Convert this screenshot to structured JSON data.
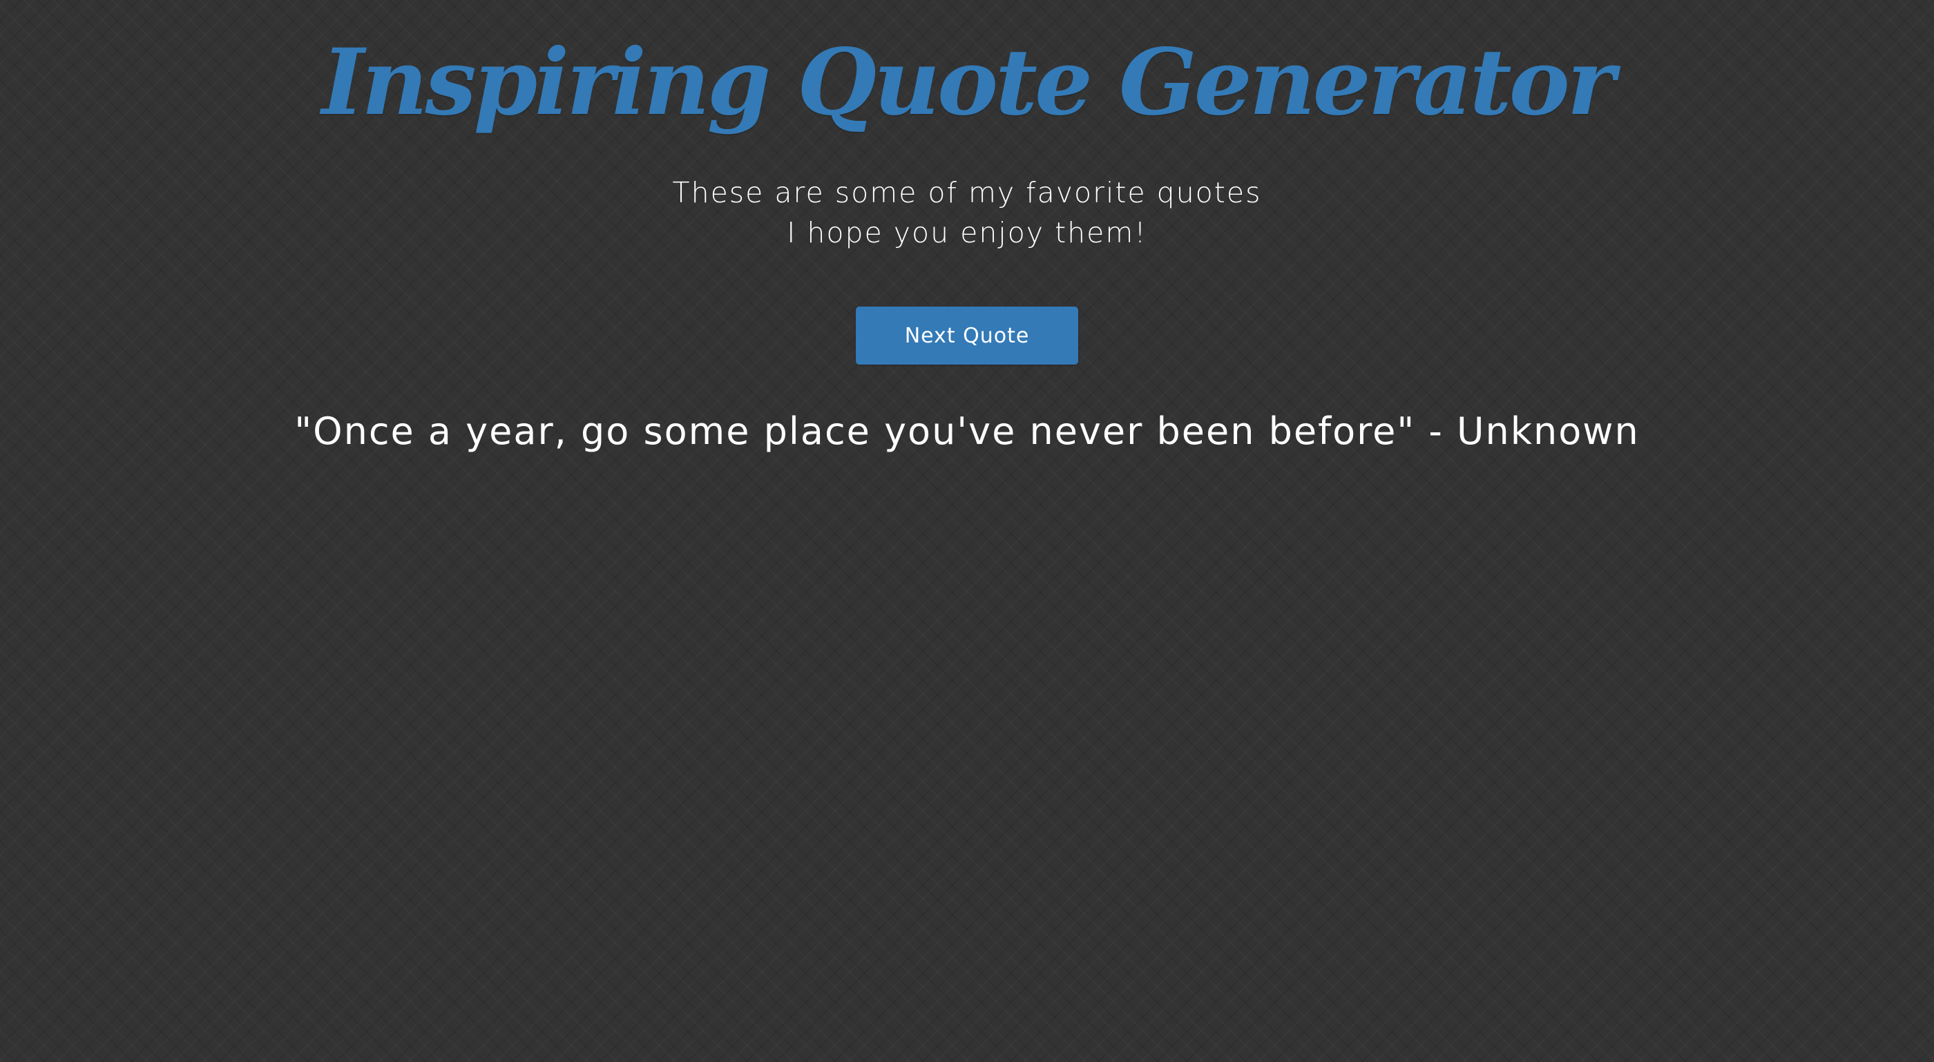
{
  "header": {
    "title": "Inspiring Quote Generator",
    "subtitle_line1": "These are some of my favorite quotes",
    "subtitle_line2": "I hope you enjoy them!"
  },
  "actions": {
    "next_quote_label": "Next Quote"
  },
  "quote": {
    "text": "\"Once a year, go some place you've never been before\" - Unknown"
  },
  "colors": {
    "accent": "#337ab7",
    "background": "#333333",
    "text": "#ffffff"
  }
}
